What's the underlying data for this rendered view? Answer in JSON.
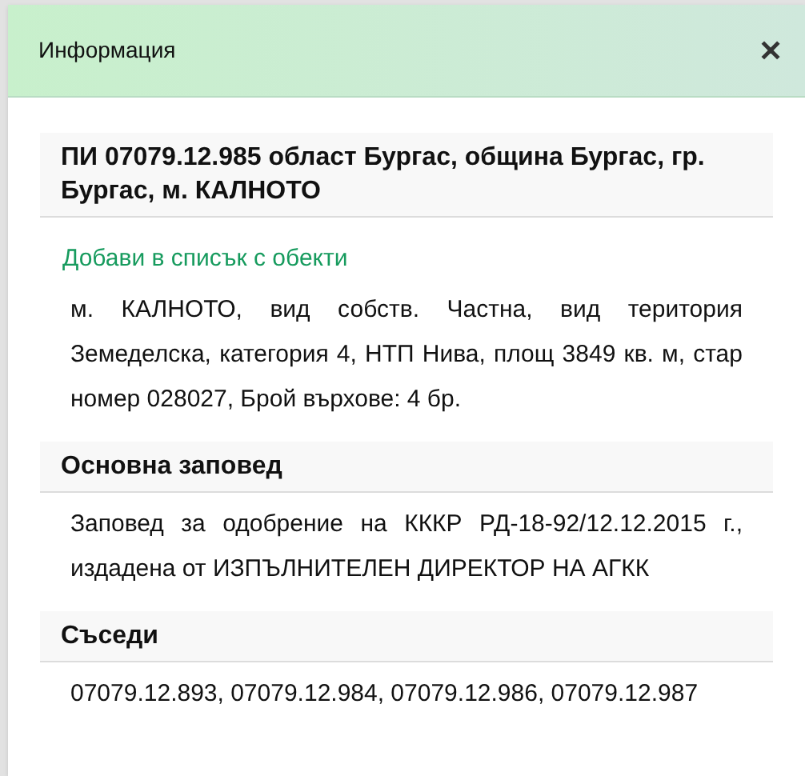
{
  "dialog": {
    "title": "Информация",
    "close": "✕"
  },
  "sections": [
    {
      "heading": "ПИ 07079.12.985 област Бургас, община Бургас, гр. Бургас, м. КАЛНОТО",
      "link": "Добави в списък с обекти",
      "text": "м. КАЛНОТО, вид собств. Частна, вид територия Земеделска, категория 4, НТП Нива, площ 3849 кв. м, стар номер 028027, Брой върхове: 4 бр."
    },
    {
      "heading": "Основна заповед",
      "text": "Заповед за одобрение на КККР РД-18-92/12.12.2015 г., издадена от ИЗПЪЛНИТЕЛЕН ДИРЕКТОР НА АГКК"
    },
    {
      "heading": "Съседи",
      "text": "07079.12.893, 07079.12.984, 07079.12.986, 07079.12.987"
    }
  ]
}
